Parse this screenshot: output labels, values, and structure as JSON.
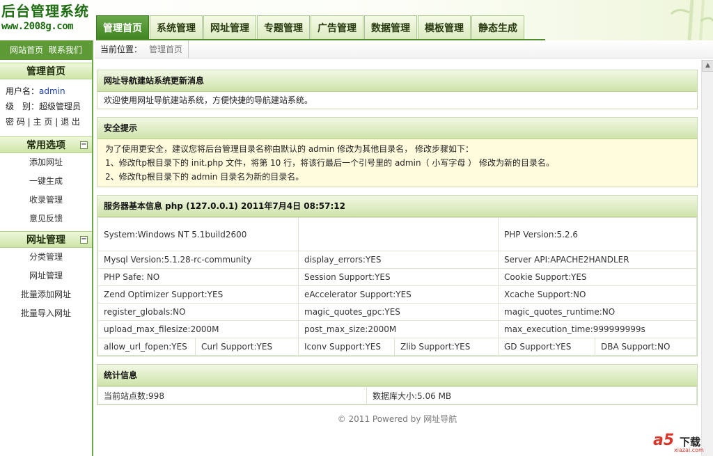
{
  "header": {
    "logo_title": "后台管理系统",
    "logo_url": "www.2008g.com",
    "nav_tabs": [
      {
        "label": "管理首页",
        "active": true
      },
      {
        "label": "系统管理"
      },
      {
        "label": "网址管理"
      },
      {
        "label": "专题管理"
      },
      {
        "label": "广告管理"
      },
      {
        "label": "数据管理"
      },
      {
        "label": "模板管理"
      },
      {
        "label": "静态生成"
      }
    ]
  },
  "sidebar": {
    "top_links": [
      "网站首页",
      "联系我们"
    ],
    "home_section": {
      "title": "管理首页",
      "username_label": "用户名：",
      "username": "admin",
      "level_label": "级　别：",
      "level": "超级管理员",
      "links": [
        "密 码",
        "主 页",
        "退 出"
      ]
    },
    "common_section": {
      "title": "常用选项",
      "collapse": "−",
      "items": [
        "添加网址",
        "一键生成",
        "收录管理",
        "意见反馈"
      ]
    },
    "url_section": {
      "title": "网址管理",
      "collapse": "−",
      "items": [
        "分类管理",
        "网址管理",
        "批量添加网址",
        "批量导入网址"
      ]
    }
  },
  "breadcrumb": {
    "label": "当前位置：",
    "item": "管理首页"
  },
  "panels": {
    "update": {
      "title": "网址导航建站系统更新消息",
      "body": "欢迎使用网址导航建站系统，方便快捷的导航建站系统。"
    },
    "security": {
      "title": "安全提示",
      "line1": "为了使用更安全，建议您将后台管理目录名称由默认的  admin   修改为其他目录名，  修改步骤如下：",
      "line2": "1、修改ftp根目录下的  init.php 文件，将第  10 行，将该行最后一个引号里的  admin（ 小写字母 ） 修改为新的目录名。",
      "line3": "2、修改ftp根目录下的  admin 目录名为新的目录名。"
    },
    "server": {
      "title": "服务器基本信息  php (127.0.0.1)  2011年7月4日  08:57:12",
      "row1": [
        "System:Windows NT 5.1build2600",
        "",
        "PHP Version:5.2.6"
      ],
      "row2": [
        "Mysql Version:5.1.28-rc-community",
        "display_errors:YES",
        "Server API:APACHE2HANDLER"
      ],
      "row3": [
        "PHP Safe: NO",
        "Session Support:YES",
        "Cookie Support:YES"
      ],
      "row4": [
        "Zend Optimizer Support:YES",
        "eAccelerator Support:YES",
        "Xcache Support:NO"
      ],
      "row5": [
        "register_globals:NO",
        "magic_quotes_gpc:YES",
        "magic_quotes_runtime:NO"
      ],
      "row6": [
        "upload_max_filesize:2000M",
        "post_max_size:2000M",
        "max_execution_time:999999999s"
      ],
      "row7": [
        "allow_url_fopen:YES",
        "Curl Support:YES",
        "Iconv Support:YES",
        "Zlib Support:YES",
        "GD Support:YES",
        "DBA Support:NO"
      ]
    },
    "stats": {
      "title": "统计信息",
      "sites": "当前站点数:998",
      "db_size": "数据库大小:5.06 MB"
    }
  },
  "footer": "© 2011 Powered by 网址导航",
  "watermark": {
    "logo": "a5",
    "text": "下载",
    "url": "xiazai.com"
  },
  "colors": {
    "nav_active": "#4a9a2c",
    "sidebar_bar": "#5d9a35",
    "panel_head": "#cfe3ab",
    "notice_bg": "#fffbdc"
  }
}
